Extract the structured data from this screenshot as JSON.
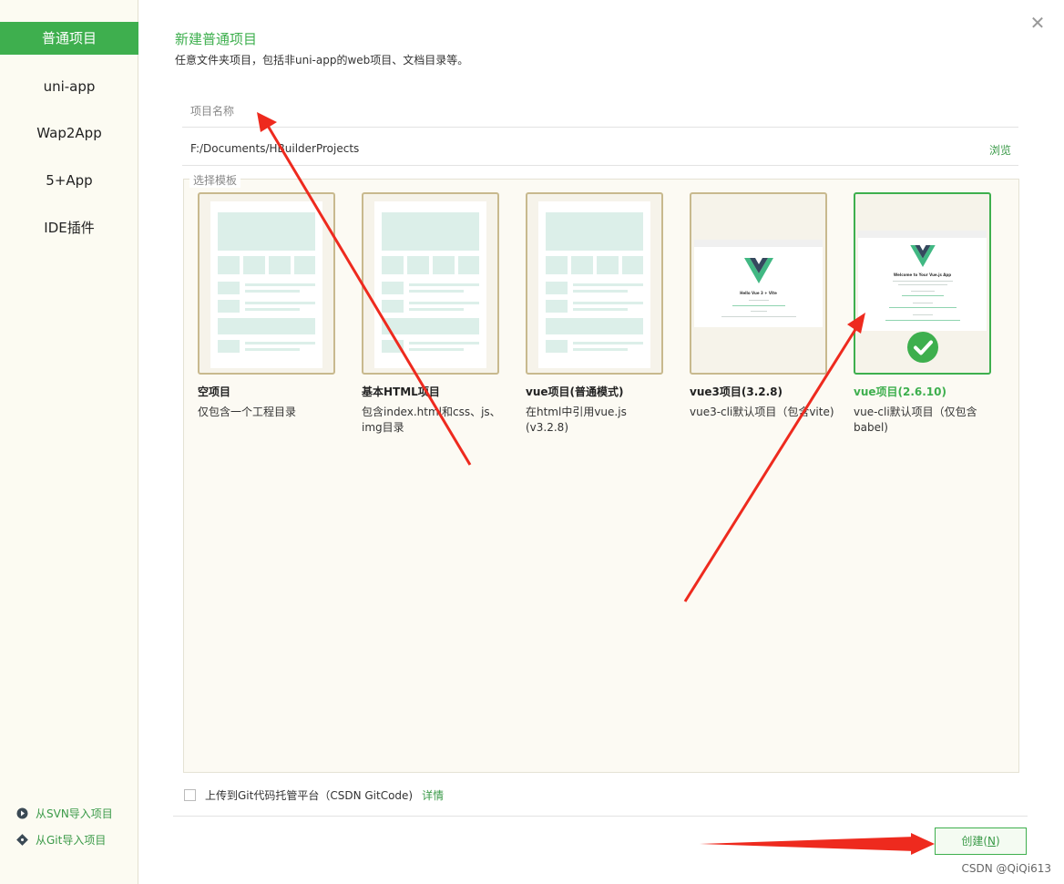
{
  "sidebar": {
    "items": [
      {
        "label": "普通项目",
        "active": true
      },
      {
        "label": "uni-app"
      },
      {
        "label": "Wap2App"
      },
      {
        "label": "5+App"
      },
      {
        "label": "IDE插件"
      }
    ],
    "svn_import": "从SVN导入项目",
    "git_import": "从Git导入项目"
  },
  "header": {
    "title": "新建普通项目",
    "subtitle": "任意文件夹项目，包括非uni-app的web项目、文档目录等。"
  },
  "form": {
    "name_placeholder": "项目名称",
    "name_value": "",
    "path": "F:/Documents/HBuilderProjects",
    "browse_label": "浏览",
    "template_legend": "选择模板"
  },
  "templates": [
    {
      "name": "空项目",
      "desc": "仅包含一个工程目录"
    },
    {
      "name": "基本HTML项目",
      "desc": "包含index.html和css、js、img目录"
    },
    {
      "name": "vue项目(普通模式)",
      "desc": "在html中引用vue.js (v3.2.8)"
    },
    {
      "name": "vue3项目(3.2.8)",
      "desc": "vue3-cli默认项目（包含vite)",
      "preview_title": "Hello Vue 3 + Vite"
    },
    {
      "name": "vue项目(2.6.10)",
      "desc": "vue-cli默认项目（仅包含babel)",
      "selected": true,
      "preview_title": "Welcome to Your Vue.js App"
    }
  ],
  "git_upload": {
    "label": "上传到Git代码托管平台（CSDN GitCode)",
    "checked": false,
    "detail_label": "详情"
  },
  "create_button": {
    "label": "创建(",
    "mnemonic": "N",
    "suffix": ")"
  },
  "watermark": "CSDN @QiQi613",
  "colors": {
    "accent": "#3eaf4e",
    "annotation_arrow": "#ee2a1e",
    "card_border": "#c8b98e"
  }
}
